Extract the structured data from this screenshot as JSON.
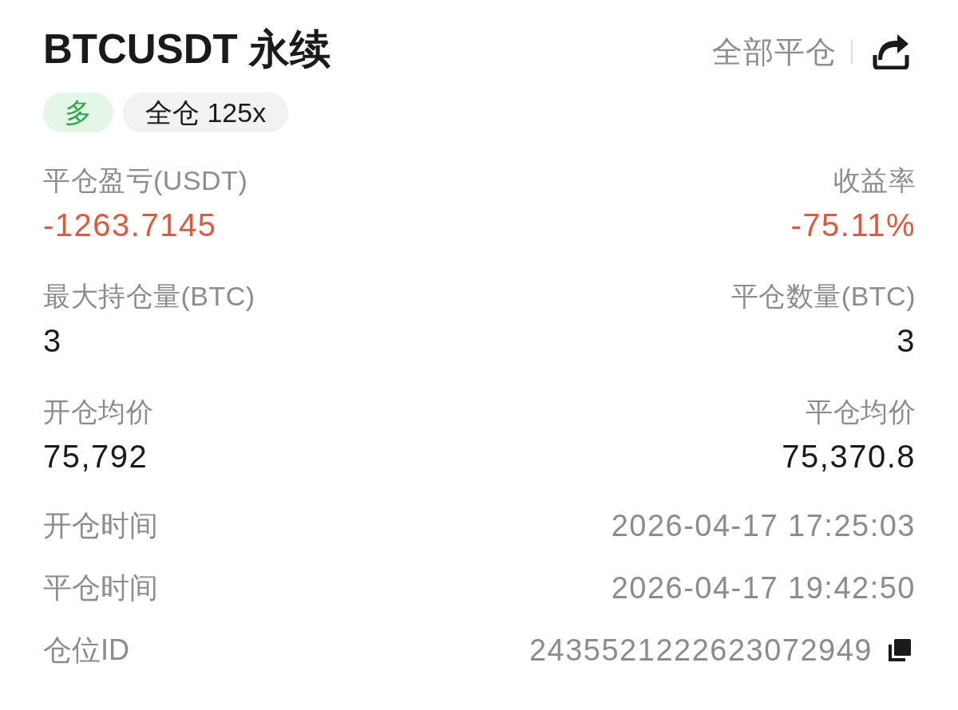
{
  "header": {
    "title": "BTCUSDT 永续",
    "close_all": "全部平仓"
  },
  "tags": [
    {
      "kind": "side",
      "label": "多"
    },
    {
      "kind": "margin",
      "label": "全仓 125x"
    }
  ],
  "stats": [
    {
      "label": "平仓盈亏(USDT)",
      "value": "-1263.7145",
      "color": "#dc5a3e"
    },
    {
      "label": "收益率",
      "value": "-75.11%",
      "color": "#dc5a3e"
    },
    {
      "label": "最大持仓量(BTC)",
      "value": "3",
      "color": "#1a1a1a"
    },
    {
      "label": "平仓数量(BTC)",
      "value": "3",
      "color": "#1a1a1a"
    },
    {
      "label": "开仓均价",
      "value": "75,792",
      "color": "#1a1a1a"
    },
    {
      "label": "平仓均价",
      "value": "75,370.8",
      "color": "#1a1a1a"
    }
  ],
  "details": [
    {
      "label": "开仓时间",
      "value": "2026-04-17 17:25:03",
      "copyable": false
    },
    {
      "label": "平仓时间",
      "value": "2026-04-17 19:42:50",
      "copyable": false
    },
    {
      "label": "仓位ID",
      "value": "2435521222623072949",
      "copyable": true
    }
  ]
}
